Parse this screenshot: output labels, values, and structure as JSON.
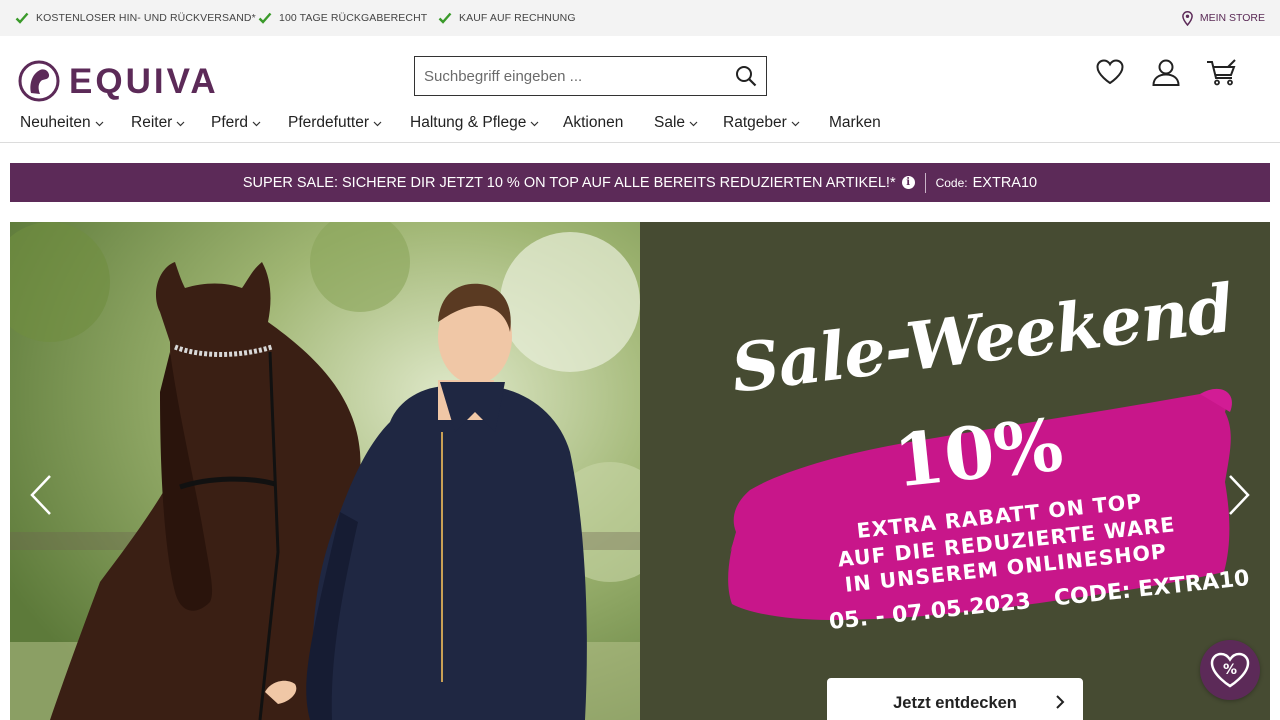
{
  "topbar": {
    "usps": [
      "KOSTENLOSER HIN- UND RÜCKVERSAND*",
      "100 TAGE RÜCKGABERECHT",
      "KAUF AUF RECHNUNG"
    ],
    "store_link": "MEIN STORE"
  },
  "header": {
    "logo_text": "EQUIVA",
    "search_placeholder": "Suchbegriff eingeben ...",
    "icons": [
      "heart-icon",
      "user-icon",
      "cart-icon"
    ]
  },
  "nav": {
    "items": [
      {
        "label": "Neuheiten",
        "dropdown": true
      },
      {
        "label": "Reiter",
        "dropdown": true
      },
      {
        "label": "Pferd",
        "dropdown": true
      },
      {
        "label": "Pferdefutter",
        "dropdown": true
      },
      {
        "label": "Haltung & Pflege",
        "dropdown": true
      },
      {
        "label": "Aktionen",
        "dropdown": false
      },
      {
        "label": "Sale",
        "dropdown": true
      },
      {
        "label": "Ratgeber",
        "dropdown": true
      },
      {
        "label": "Marken",
        "dropdown": false
      }
    ]
  },
  "promo": {
    "text": "SUPER SALE: SICHERE DIR JETZT 10 % ON TOP AUF ALLE BEREITS REDUZIERTEN ARTIKEL!*",
    "code_label": "Code:",
    "code": "EXTRA10"
  },
  "hero": {
    "title": "Sale-Weekend",
    "percent": "10%",
    "lines": [
      "EXTRA RABATT ON TOP",
      "AUF DIE REDUZIERTE WARE",
      "IN UNSEREM ONLINESHOP"
    ],
    "dates": "05. - 07.05.2023",
    "code_text": "CODE: EXTRA10",
    "cta": "Jetzt entdecken"
  },
  "colors": {
    "brand": "#5c2a58",
    "check": "#3a9a2a",
    "hero_bg": "#464b32",
    "brush": "#c8168a"
  }
}
